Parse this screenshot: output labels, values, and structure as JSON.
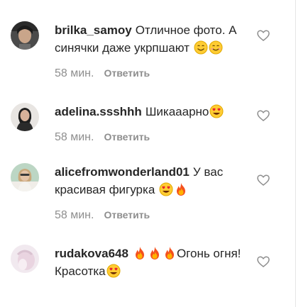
{
  "comments": [
    {
      "username": "brilka_samoy",
      "text": "Отличное фото. А синячки даже укрпшают",
      "emojis": [
        "smiling-face-icon",
        "smiling-face-icon"
      ],
      "time": "58 мин.",
      "reply_label": "Ответить"
    },
    {
      "username": "adelina.ssshhh",
      "text": "Шикааарно",
      "emojis": [
        "heart-eyes-emoji-icon"
      ],
      "time": "58 мин.",
      "reply_label": "Ответить"
    },
    {
      "username": "alicefromwonderland01",
      "text": "У вас красивая фигурка",
      "emojis": [
        "heart-eyes-emoji-icon",
        "fire-emoji-icon"
      ],
      "time": "58 мин.",
      "reply_label": "Ответить"
    },
    {
      "username": "rudakova648",
      "text_pre_emojis": [
        "fire-emoji-icon",
        "fire-emoji-icon",
        "fire-emoji-icon"
      ],
      "text": "Огонь огня! Красотка",
      "emojis": [
        "heart-eyes-emoji-icon"
      ],
      "time": "",
      "reply_label": ""
    }
  ],
  "colors": {
    "text": "#262626",
    "meta": "#8e8e8e",
    "heart_outline": "#8e8e8e"
  }
}
